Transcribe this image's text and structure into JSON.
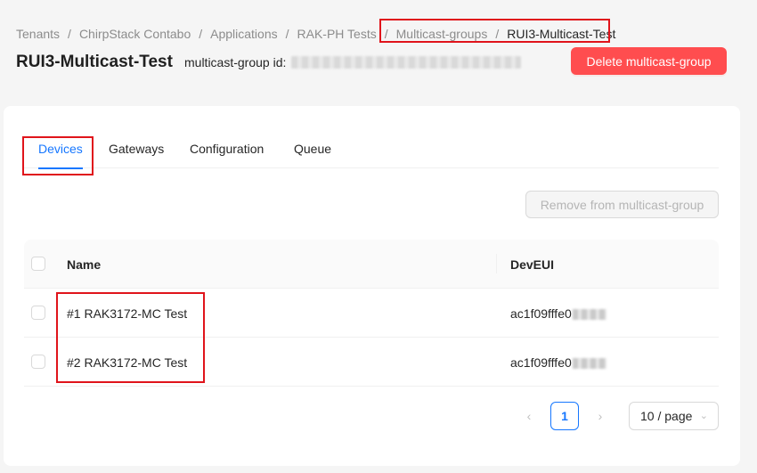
{
  "breadcrumb": {
    "items": [
      "Tenants",
      "ChirpStack Contabo",
      "Applications",
      "RAK-PH Tests",
      "Multicast-groups",
      "RUI3-Multicast-Test"
    ],
    "separator": "/"
  },
  "header": {
    "title": "RUI3-Multicast-Test",
    "id_label": "multicast-group id:",
    "delete_label": "Delete multicast-group"
  },
  "tabs": [
    {
      "label": "Devices",
      "active": true
    },
    {
      "label": "Gateways",
      "active": false
    },
    {
      "label": "Configuration",
      "active": false
    },
    {
      "label": "Queue",
      "active": false
    }
  ],
  "toolbar": {
    "remove_label": "Remove from multicast-group"
  },
  "table": {
    "columns": [
      "Name",
      "DevEUI"
    ],
    "rows": [
      {
        "name": "#1 RAK3172-MC Test",
        "deveui": "ac1f09fffe0"
      },
      {
        "name": "#2 RAK3172-MC Test",
        "deveui": "ac1f09fffe0"
      }
    ]
  },
  "pagination": {
    "prev_icon": "chevron-left-icon",
    "next_icon": "chevron-right-icon",
    "current_page": "1",
    "page_size": "10 / page"
  },
  "colors": {
    "primary": "#1677ff",
    "danger": "#ff4d4f",
    "highlight": "#e0141b"
  }
}
